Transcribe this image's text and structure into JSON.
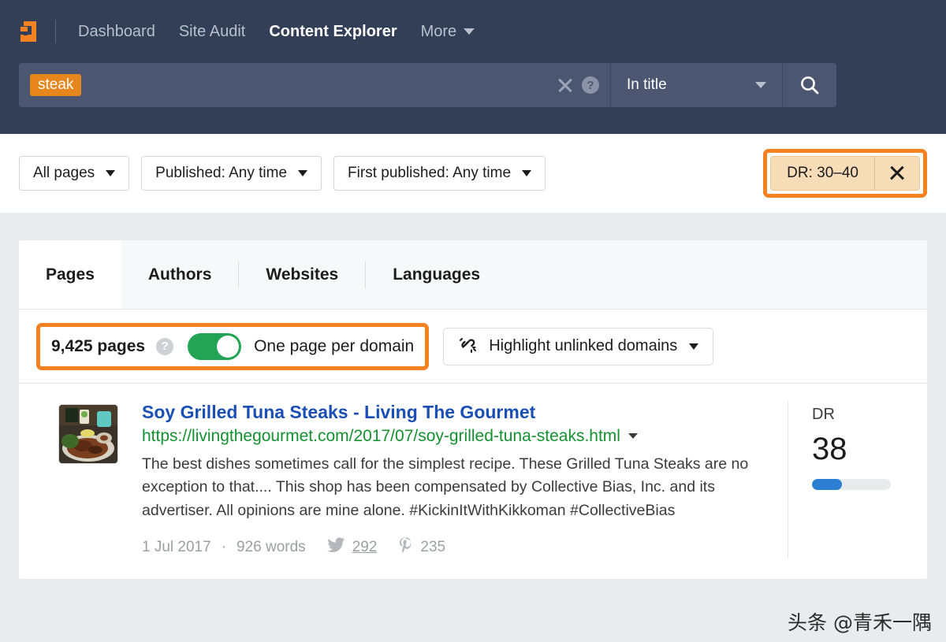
{
  "brand": {
    "logo_icon": "ahrefs-a-logo",
    "accent_orange": "#f58220",
    "header_bg": "#333f57",
    "toggle_green": "#23a455",
    "link_blue": "#1a4fb5",
    "url_green": "#13912f",
    "dr_bar_blue": "#2d7fd3"
  },
  "nav": {
    "items": [
      {
        "label": "Dashboard",
        "active": false
      },
      {
        "label": "Site Audit",
        "active": false
      },
      {
        "label": "Content Explorer",
        "active": true
      },
      {
        "label": "More",
        "active": false
      }
    ]
  },
  "search": {
    "token": "steak",
    "placeholder": "",
    "clear_icon": "close-icon",
    "help_icon": "help-circle-icon",
    "scope": "In title",
    "search_icon": "search-icon"
  },
  "filters": {
    "buttons": [
      {
        "label": "All pages"
      },
      {
        "label": "Published: Any time"
      },
      {
        "label": "First published: Any time"
      }
    ],
    "active_chip": {
      "label": "DR: 30–40",
      "remove_icon": "close-icon"
    }
  },
  "tabs": [
    {
      "label": "Pages",
      "active": true
    },
    {
      "label": "Authors",
      "active": false
    },
    {
      "label": "Websites",
      "active": false
    },
    {
      "label": "Languages",
      "active": false
    }
  ],
  "toolbar": {
    "pages_count": "9,425 pages",
    "pages_help_icon": "help-circle-icon",
    "toggle_on": true,
    "toggle_label": "One page per domain",
    "highlight": {
      "icon": "broken-link-icon",
      "label": "Highlight unlinked domains"
    }
  },
  "results": [
    {
      "thumbnail": "food-plate-thumbnail",
      "title": "Soy Grilled Tuna Steaks - Living The Gourmet",
      "url": "https://livingthegourmet.com/2017/07/soy-grilled-tuna-steaks.html",
      "url_caret_icon": "chevron-down-icon",
      "description": "The best dishes sometimes call for the simplest recipe. These Grilled Tuna Steaks are no exception to that.... This shop has been compensated by Collective Bias, Inc. and its advertiser. All opinions are mine alone. #KickinItWithKikkoman #CollectiveBias",
      "date": "1 Jul 2017",
      "separator": "·",
      "words": "926 words",
      "twitter_icon": "twitter-bird-icon",
      "twitter_count": "292",
      "pinterest_icon": "pinterest-icon",
      "pinterest_count": "235",
      "dr_label": "DR",
      "dr_value": "38",
      "dr_percent": 38
    }
  ],
  "watermark": "头条 @青禾一隅"
}
